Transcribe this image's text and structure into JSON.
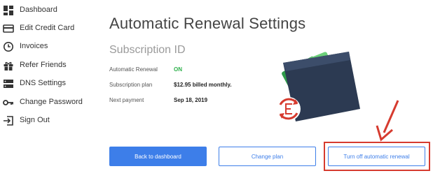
{
  "sidebar": {
    "items": [
      {
        "label": "Dashboard",
        "icon": "dashboard-icon"
      },
      {
        "label": "Edit Credit Card",
        "icon": "credit-card-icon"
      },
      {
        "label": "Invoices",
        "icon": "clock-icon"
      },
      {
        "label": "Refer Friends",
        "icon": "gift-icon"
      },
      {
        "label": "DNS Settings",
        "icon": "server-icon"
      },
      {
        "label": "Change Password",
        "icon": "key-icon"
      },
      {
        "label": "Sign Out",
        "icon": "sign-out-icon"
      }
    ]
  },
  "main": {
    "title": "Automatic Renewal Settings",
    "subtitle": "Subscription ID",
    "details": [
      {
        "label": "Automatic Renewal",
        "value": "ON"
      },
      {
        "label": "Subscription plan",
        "value": "$12.95 billed monthly."
      },
      {
        "label": "Next payment",
        "value": "Sep 18, 2019"
      }
    ],
    "buttons": {
      "back": "Back to dashboard",
      "change_plan": "Change plan",
      "turn_off": "Turn off automatic renewal"
    }
  },
  "colors": {
    "accent": "#3d7ee9",
    "status_on": "#2fb14c",
    "highlight": "#d63b2f"
  }
}
